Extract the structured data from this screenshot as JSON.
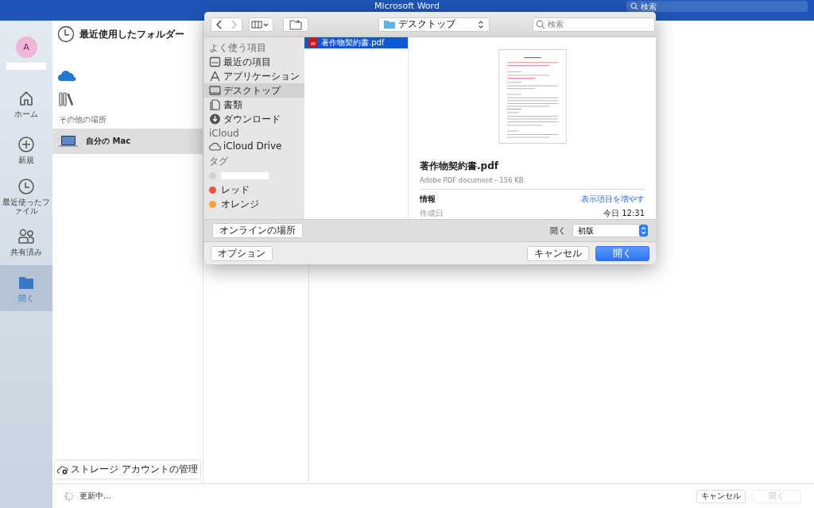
{
  "window": {
    "title": "Microsoft Word",
    "search_placeholder": "検索"
  },
  "nav": {
    "avatar": "A",
    "items": [
      {
        "label": "ホーム",
        "kind": "home",
        "selected": false
      },
      {
        "label": "新規",
        "kind": "plus",
        "selected": false
      },
      {
        "label": "最近使ったファイル",
        "kind": "clock",
        "selected": false
      },
      {
        "label": "共有済み",
        "kind": "people",
        "selected": false
      },
      {
        "label": "開く",
        "kind": "folder",
        "selected": true
      }
    ]
  },
  "locations": {
    "recent": "最近使用したフォルダー",
    "section": "その他の場所",
    "items": [
      {
        "label": "自分の Mac",
        "selected": true
      }
    ],
    "storage_button": "ストレージ アカウントの管理"
  },
  "status": "更新中...",
  "footer": {
    "cancel": "キャンセル",
    "open": {
      "label": "開く",
      "disabled": true
    }
  },
  "dialog": {
    "location": "デスクトップ",
    "search_placeholder": "検索",
    "sidebar": [
      {
        "title": "よく使う項目",
        "items": [
          {
            "label": "最近の項目",
            "kind": "recents",
            "selected": false
          },
          {
            "label": "アプリケーション",
            "kind": "apps",
            "selected": false
          },
          {
            "label": "デスクトップ",
            "kind": "desktop",
            "selected": true
          },
          {
            "label": "書類",
            "kind": "docs",
            "selected": false
          },
          {
            "label": "ダウンロード",
            "kind": "download",
            "selected": false
          }
        ]
      },
      {
        "title": "iCloud",
        "items": [
          {
            "label": "iCloud Drive",
            "kind": "cloud",
            "selected": false
          }
        ]
      },
      {
        "title": "タグ",
        "items": [
          {
            "kind": "tag",
            "color": "#d0d0d0",
            "selected": false
          },
          {
            "label": "レッド",
            "kind": "tag",
            "color": "#f0504a",
            "selected": false
          },
          {
            "label": "オレンジ",
            "kind": "tag",
            "color": "#f6a035",
            "selected": false
          }
        ]
      }
    ],
    "files": [
      {
        "name": "著作物契約書.pdf",
        "selected": true
      }
    ],
    "preview": {
      "name": "著作物契約書.pdf",
      "description": "Adobe PDF document - 156 KB",
      "info": "情報",
      "more": "表示項目を増やす",
      "rows": [
        {
          "label": "作成日",
          "value": "今日 12:31"
        }
      ]
    },
    "online_button": "オンラインの場所",
    "open_with_label": "開く",
    "version": "初版",
    "options_button": "オプション",
    "cancel": "キャンセル",
    "open": "開く"
  }
}
